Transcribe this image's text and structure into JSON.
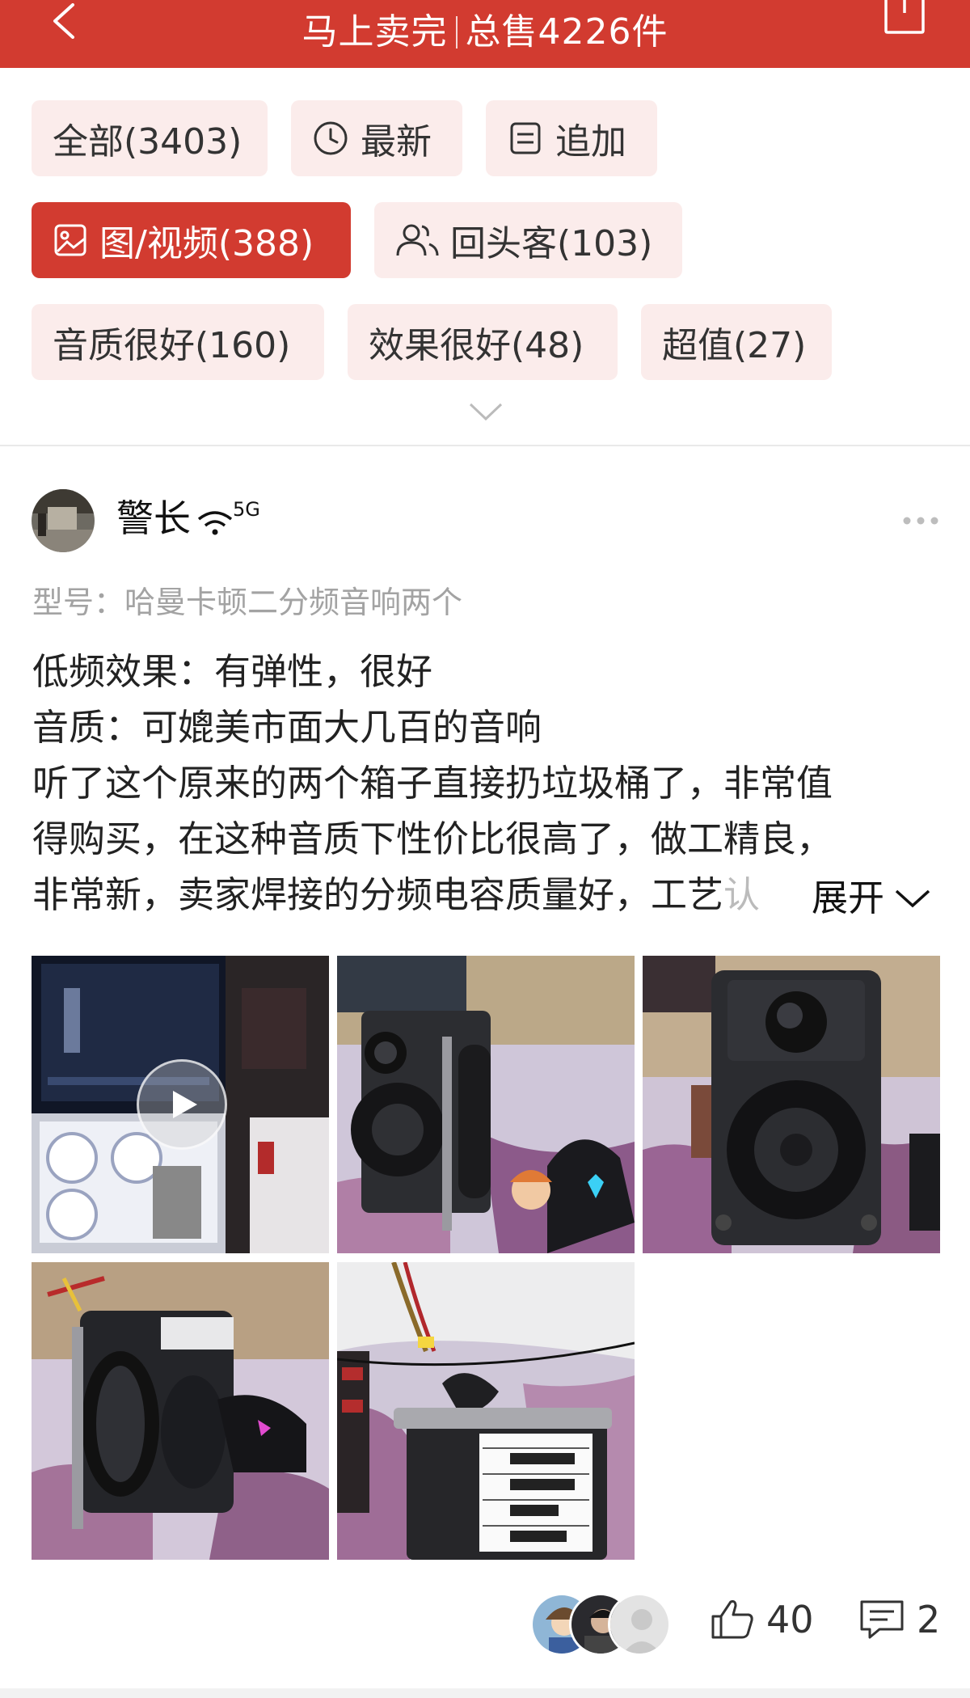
{
  "header": {
    "title_left": "马上卖完",
    "title_right": "总售4226件",
    "accent_color": "#d23b30"
  },
  "filters": {
    "row1": [
      {
        "label": "全部(3403)",
        "icon": null
      },
      {
        "label": "最新",
        "icon": "clock-icon"
      },
      {
        "label": "追加",
        "icon": "note-icon"
      }
    ],
    "row2": [
      {
        "label": "图/视频(388)",
        "icon": "image-icon",
        "active": true
      },
      {
        "label": "回头客(103)",
        "icon": "users-icon"
      }
    ],
    "row3": [
      {
        "label": "音质很好(160)"
      },
      {
        "label": "效果很好(48)"
      },
      {
        "label": "超值(27)"
      }
    ]
  },
  "review": {
    "username": "警长",
    "network_badge": "5G",
    "model": "型号：哈曼卡顿二分频音响两个",
    "lines": [
      "低频效果：有弹性，很好",
      "音质：可媲美市面大几百的音响",
      "听了这个原来的两个箱子直接扔垃圾桶了，非常值",
      "得购买，在这种音质下性价比很高了，做工精良，",
      "非常新，卖家焊接的分频电容质量好，工艺"
    ],
    "faded_tail": "认",
    "expand_label": "展开",
    "photo_count": 5,
    "has_video": true
  },
  "footer": {
    "like_count": "40",
    "comment_count": "2"
  }
}
